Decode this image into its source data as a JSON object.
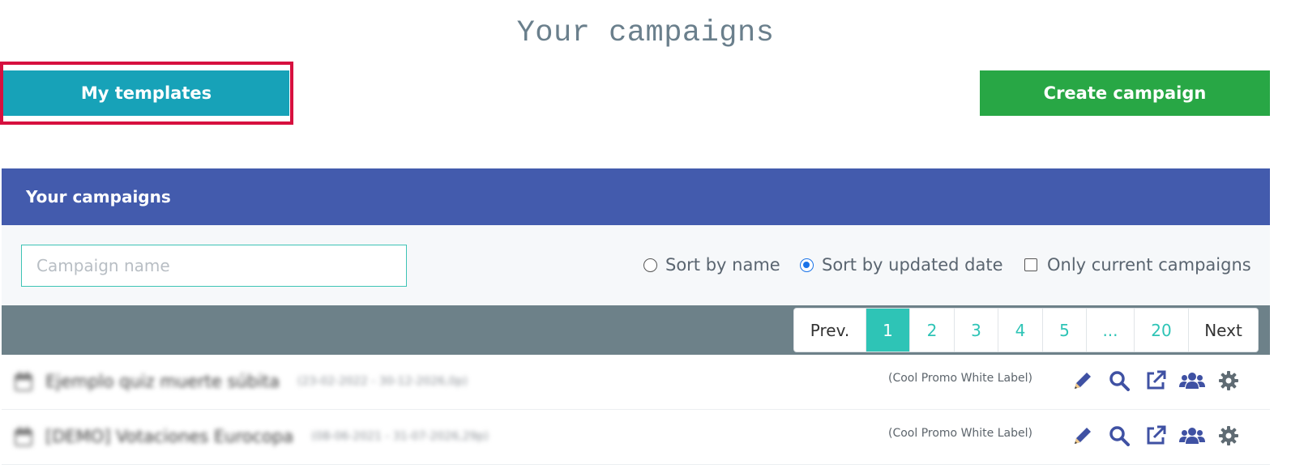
{
  "page": {
    "title": "Your campaigns"
  },
  "toolbar": {
    "templates_label": "My templates",
    "create_label": "Create campaign"
  },
  "panel": {
    "title": "Your campaigns"
  },
  "filters": {
    "search_placeholder": "Campaign name",
    "sort_by_name": "Sort by name",
    "sort_by_updated": "Sort by updated date",
    "only_current": "Only current campaigns",
    "selected_sort": "updated"
  },
  "pagination": {
    "prev": "Prev.",
    "next": "Next",
    "pages": [
      "1",
      "2",
      "3",
      "4",
      "5",
      "...",
      "20"
    ],
    "current": "1"
  },
  "campaigns": [
    {
      "name": "Ejemplo quiz muerte súbita",
      "dates": "(23-02-2022 - 30-12-2026,0p)",
      "label": "(Cool Promo White Label)"
    },
    {
      "name": "[DEMO] Votaciones Eurocopa",
      "dates": "(08-06-2021 - 31-07-2026,29p)",
      "label": "(Cool Promo White Label)"
    }
  ],
  "colors": {
    "templates_button": "#17a2b8",
    "create_button": "#28a745",
    "panel_header": "#435bad",
    "pager_bar": "#6d8189",
    "page_active": "#2ec4b6",
    "action_icons": "#3f51a3",
    "settings_icon": "#5f6b73",
    "highlight": "#d6103f"
  },
  "icons": [
    "calendar-icon",
    "pencil-icon",
    "search-icon",
    "external-link-icon",
    "users-icon",
    "gear-icon"
  ]
}
